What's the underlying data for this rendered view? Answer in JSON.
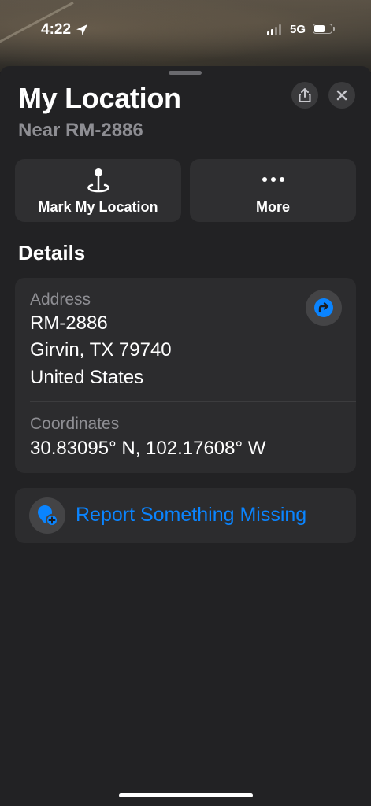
{
  "status_bar": {
    "time": "4:22",
    "network": "5G",
    "signal_bars_active": 2,
    "signal_bars_total": 4,
    "battery_level": 0.7
  },
  "place": {
    "title": "My Location",
    "subtitle": "Near RM-2886"
  },
  "actions": [
    {
      "label": "Mark My Location",
      "icon": "location-pin-icon"
    },
    {
      "label": "More",
      "icon": "ellipsis-icon"
    }
  ],
  "details": {
    "section_title": "Details",
    "address_label": "Address",
    "address_lines": [
      "RM-2886",
      "Girvin, TX  79740",
      "United States"
    ],
    "coordinates_label": "Coordinates",
    "coordinates_value": "30.83095° N, 102.17608° W"
  },
  "report": {
    "label": "Report Something Missing"
  },
  "colors": {
    "accent": "#0a84ff",
    "sheet_background": "#222224",
    "card_background": "#2c2c2e",
    "secondary_text": "#8e8e93"
  }
}
